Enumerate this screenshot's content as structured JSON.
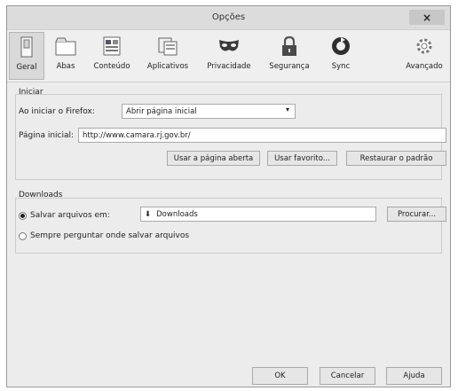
{
  "window": {
    "title": "Opções",
    "close_glyph": "×"
  },
  "tabs": [
    {
      "label": "Geral",
      "icon": "switch-icon",
      "selected": true
    },
    {
      "label": "Abas",
      "icon": "tabs-icon",
      "selected": false
    },
    {
      "label": "Conteúdo",
      "icon": "content-icon",
      "selected": false
    },
    {
      "label": "Aplicativos",
      "icon": "applications-icon",
      "selected": false
    },
    {
      "label": "Privacidade",
      "icon": "mask-icon",
      "selected": false
    },
    {
      "label": "Segurança",
      "icon": "lock-icon",
      "selected": false
    },
    {
      "label": "Sync",
      "icon": "sync-icon",
      "selected": false
    },
    {
      "label": "Avançado",
      "icon": "gear-icon",
      "selected": false
    }
  ],
  "startup": {
    "group_title": "Iniciar",
    "when_start_label": "Ao iniciar o Firefox:",
    "when_start_value": "Abrir página inicial",
    "homepage_label": "Página inicial:",
    "homepage_value": "http://www.camara.rj.gov.br/",
    "use_current_label": "Usar a página aberta",
    "use_bookmark_label": "Usar favorito...",
    "restore_default_label": "Restaurar o padrão"
  },
  "downloads": {
    "group_title": "Downloads",
    "save_to_label": "Salvar arquivos em:",
    "save_to_folder": "Downloads",
    "browse_label": "Procurar...",
    "always_ask_label": "Sempre perguntar onde salvar arquivos",
    "save_to_selected": true
  },
  "footer": {
    "ok_label": "OK",
    "cancel_label": "Cancelar",
    "help_label": "Ajuda"
  }
}
